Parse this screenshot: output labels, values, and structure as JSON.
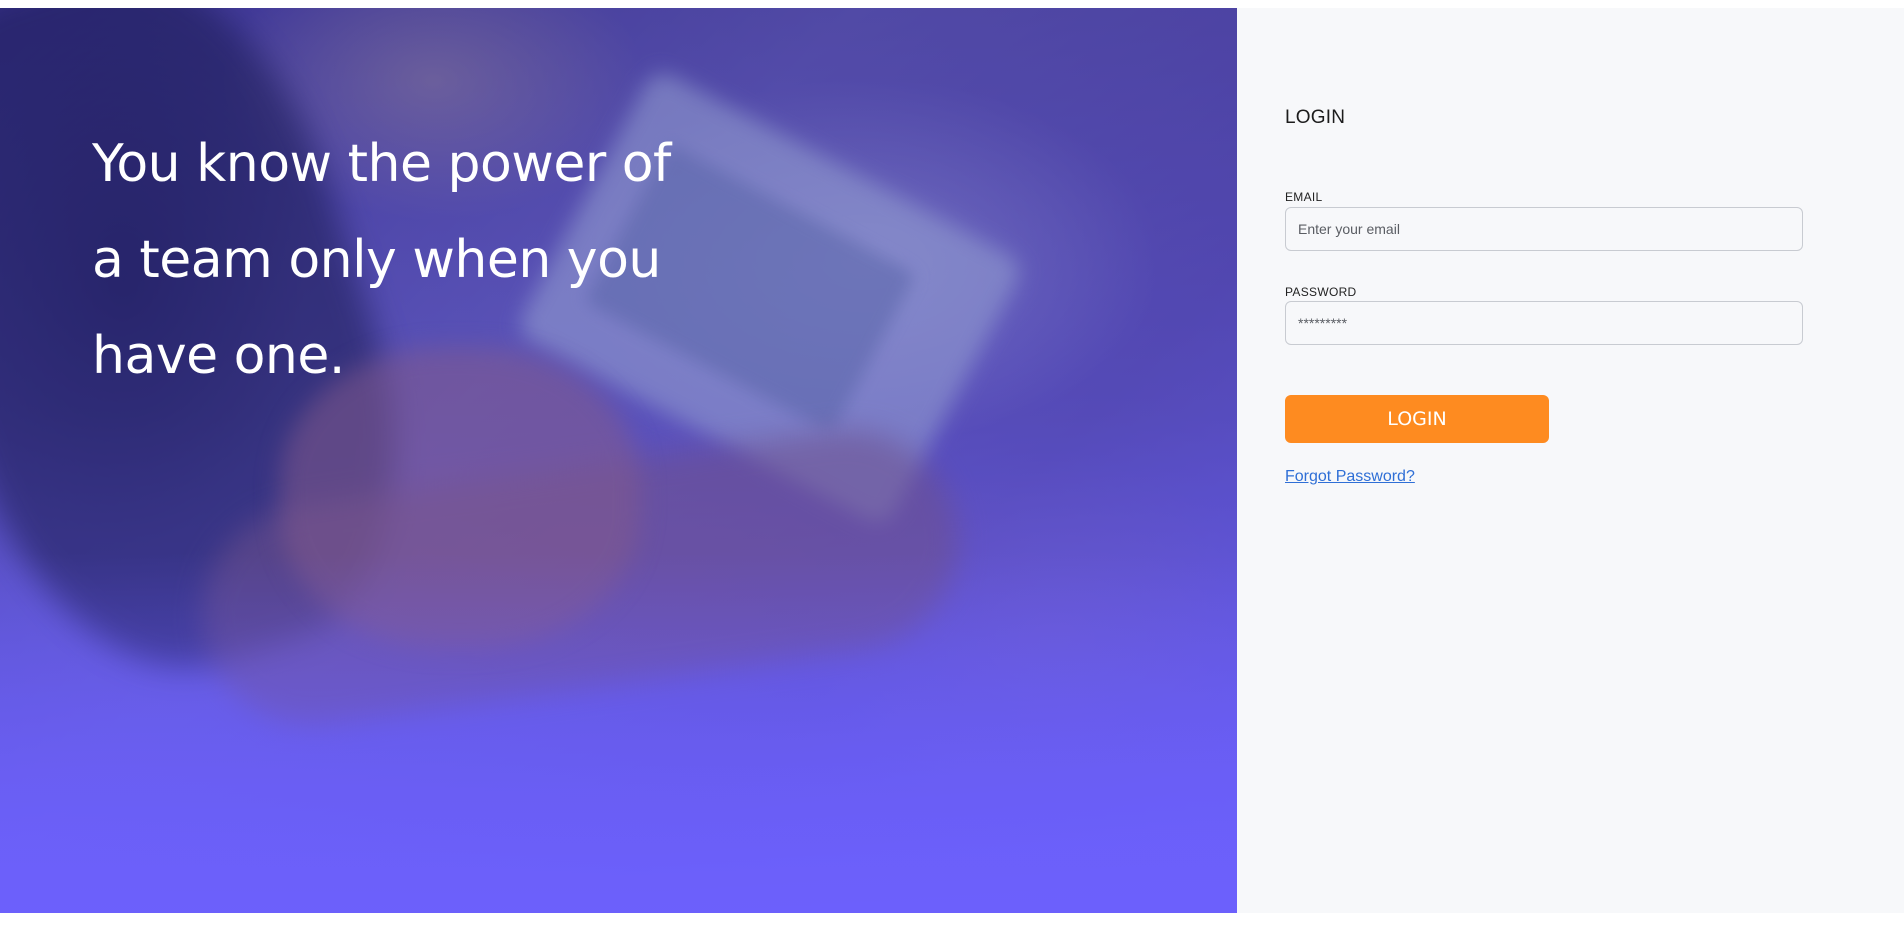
{
  "hero": {
    "tagline_lines": [
      "You know the power of",
      "a team only when you",
      "have one."
    ]
  },
  "login": {
    "title": "LOGIN",
    "email": {
      "label": "EMAIL",
      "placeholder": "Enter your email",
      "value": ""
    },
    "password": {
      "label": "PASSWORD",
      "placeholder": "*********",
      "value": ""
    },
    "submit_label": "LOGIN",
    "forgot_label": "Forgot Password?"
  },
  "colors": {
    "accent": "#fe8b20",
    "link": "#2f6fd6",
    "hero_overlay": "#6c60fc",
    "panel_background": "#f7f8fa"
  }
}
